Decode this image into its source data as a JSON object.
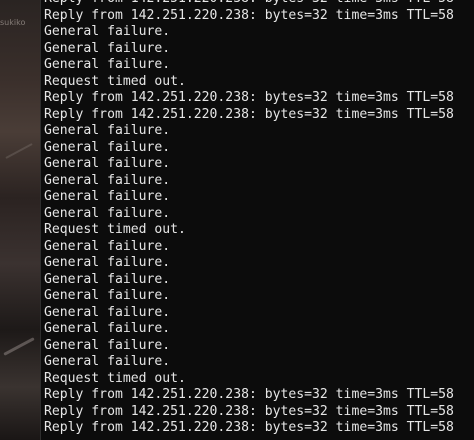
{
  "desktop": {
    "partial_label": "sukiko"
  },
  "terminal": {
    "lines": [
      "Reply from 142.251.220.238: bytes=32 time=3ms TTL=58",
      "Reply from 142.251.220.238: bytes=32 time=3ms TTL=58",
      "General failure.",
      "General failure.",
      "General failure.",
      "Request timed out.",
      "Reply from 142.251.220.238: bytes=32 time=3ms TTL=58",
      "Reply from 142.251.220.238: bytes=32 time=3ms TTL=58",
      "General failure.",
      "General failure.",
      "General failure.",
      "General failure.",
      "General failure.",
      "General failure.",
      "Request timed out.",
      "General failure.",
      "General failure.",
      "General failure.",
      "General failure.",
      "General failure.",
      "General failure.",
      "General failure.",
      "General failure.",
      "Request timed out.",
      "Reply from 142.251.220.238: bytes=32 time=3ms TTL=58",
      "Reply from 142.251.220.238: bytes=32 time=3ms TTL=58",
      "Reply from 142.251.220.238: bytes=32 time=3ms TTL=58"
    ]
  }
}
